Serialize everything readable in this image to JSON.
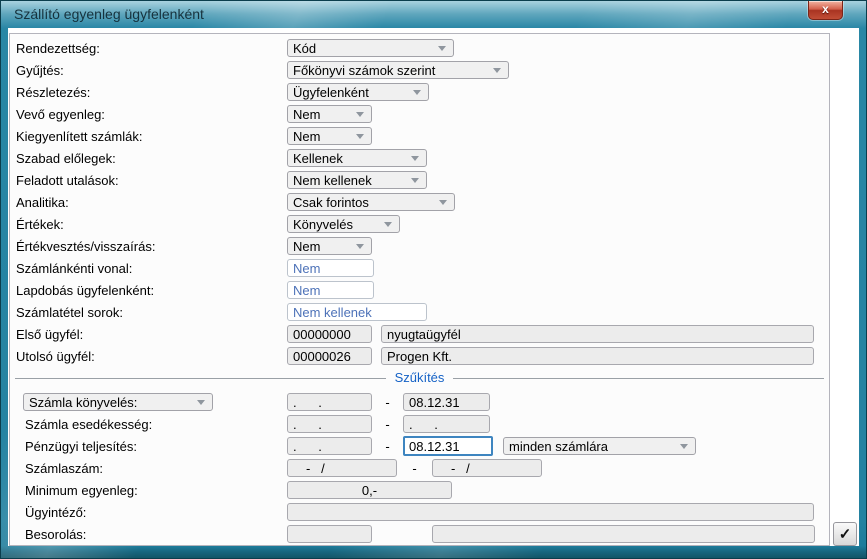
{
  "window": {
    "title": "Szállító egyenleg ügyfelenként",
    "close_glyph": "x"
  },
  "form": {
    "rendezettseg": {
      "label": "Rendezettség:",
      "value": "Kód"
    },
    "gyujtes": {
      "label": "Gyűjtés:",
      "value": "Főkönyvi számok szerint"
    },
    "reszletezes": {
      "label": "Részletezés:",
      "value": "Ügyfelenként"
    },
    "vevo_egyenleg": {
      "label": "Vevő egyenleg:",
      "value": "Nem"
    },
    "kiegyenlitett": {
      "label": "Kiegyenlített számlák:",
      "value": "Nem"
    },
    "szabad_elolegek": {
      "label": "Szabad előlegek:",
      "value": "Kellenek"
    },
    "feladott_utalasok": {
      "label": "Feladott utalások:",
      "value": "Nem kellenek"
    },
    "analitika": {
      "label": "Analitika:",
      "value": "Csak forintos"
    },
    "ertekek": {
      "label": "Értékek:",
      "value": "Könyvelés"
    },
    "ertekvesztes": {
      "label": "Értékvesztés/visszaírás:",
      "value": "Nem"
    },
    "szamlankenti_vonal": {
      "label": "Számlánkénti vonal:",
      "value": "Nem"
    },
    "lapdobas": {
      "label": "Lapdobás ügyfelenként:",
      "value": "Nem"
    },
    "szamlatetel_sorok": {
      "label": "Számlatétel sorok:",
      "value": "Nem kellenek"
    },
    "elso_ugyfel": {
      "label": "Első ügyfél:",
      "code": "00000000",
      "name": "nyugtaügyfél"
    },
    "utolso_ugyfel": {
      "label": "Utolsó ügyfél:",
      "code": "00000026",
      "name": "Progen Kft."
    }
  },
  "szukites": {
    "divider_label": "Szűkítés",
    "sep": "-",
    "empty_date": ".      .",
    "empty_invoice": "-   /",
    "szamla_konyveles": {
      "label": "Számla könyvelés:",
      "from": ".      .",
      "to": "08.12.31"
    },
    "szamla_esedekesseg": {
      "label": "Számla esedékesség:",
      "from": ".      .",
      "to": ".      ."
    },
    "penzugyi_teljesites": {
      "label": "Pénzügyi teljesítés:",
      "from": ".      .",
      "to": "08.12.31",
      "scope": "minden számlára"
    },
    "szamlaszam": {
      "label": "Számlaszám:",
      "from": "-   /",
      "to": "-   /"
    },
    "minimum_egyenleg": {
      "label": "Minimum egyenleg:",
      "value": "0,-"
    },
    "ugyintezo": {
      "label": "Ügyintéző:",
      "value": ""
    },
    "besorolas": {
      "label": "Besorolás:",
      "code": "",
      "name": ""
    }
  },
  "actions": {
    "confirm_glyph": "✓"
  }
}
